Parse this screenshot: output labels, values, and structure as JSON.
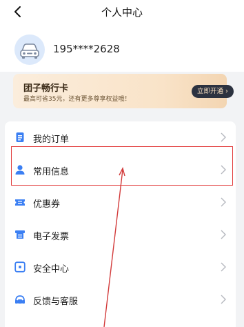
{
  "header": {
    "title": "个人中心",
    "back_icon": "chevron-left-icon"
  },
  "profile": {
    "phone": "195****2628",
    "avatar_icon": "car-icon"
  },
  "vip_card": {
    "title": "团子畅行卡",
    "subtitle": "最高可省35元，还有更多尊享权益哦！",
    "button_label": "立即开通 ›"
  },
  "menu": {
    "items": [
      {
        "label": "我的订单",
        "icon": "order-doc-icon"
      },
      {
        "label": "常用信息",
        "icon": "user-icon"
      },
      {
        "label": "优惠券",
        "icon": "coupon-icon"
      },
      {
        "label": "电子发票",
        "icon": "invoice-icon"
      },
      {
        "label": "安全中心",
        "icon": "shield-icon"
      },
      {
        "label": "反馈与客服",
        "icon": "service-phone-icon"
      }
    ]
  },
  "colors": {
    "accent_blue": "#3b7ff3",
    "highlight_red": "#e23b3b",
    "background": "#f2f3f5"
  }
}
